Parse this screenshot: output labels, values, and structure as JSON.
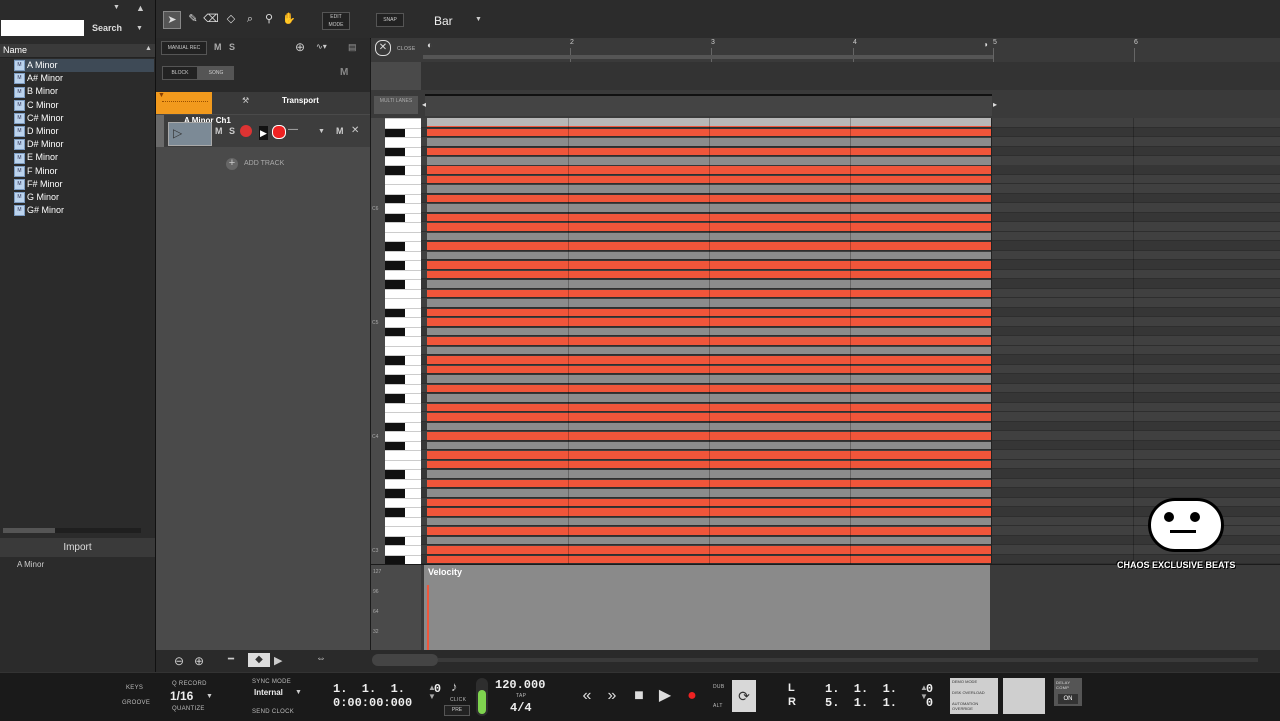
{
  "browser": {
    "search_label": "Search",
    "name_header": "Name",
    "items": [
      "A Minor",
      "A# Minor",
      "B Minor",
      "C Minor",
      "C# Minor",
      "D Minor",
      "D# Minor",
      "E Minor",
      "F Minor",
      "F# Minor",
      "G Minor",
      "G# Minor"
    ],
    "import_label": "Import",
    "selected": "A Minor"
  },
  "toolbar": {
    "edit_mode": "EDIT MODE",
    "snap": "SNAP",
    "snap_value": "Bar"
  },
  "tracks": {
    "manual_rec": "MANUAL REC",
    "m": "M",
    "s": "S",
    "block": "BLOCK",
    "song": "SONG",
    "transport_label": "Transport",
    "track_name": "A Minor Ch1",
    "add_track": "ADD TRACK"
  },
  "editor": {
    "close": "CLOSE",
    "multi_lanes": "MULTI LANES",
    "bars": [
      "2",
      "3",
      "4",
      "5",
      "6"
    ],
    "octaves": [
      "C6",
      "C5",
      "C4",
      "C3"
    ],
    "velocity_label": "Velocity",
    "velocity_ticks": [
      "127",
      "96",
      "64",
      "32"
    ],
    "note_color": "#f0553a",
    "watermark": "CHAOS EXCLUSIVE BEATS"
  },
  "status": {
    "keys": "KEYS",
    "groove": "GROOVE",
    "q_record": "Q RECORD",
    "quantize_value": "1/16",
    "quantize": "QUANTIZE",
    "sync_mode": "SYNC MODE",
    "sync_value": "Internal",
    "send_clock": "SEND CLOCK",
    "position_bars": "1.  1.  1.    0",
    "position_time": "0:00:00:000",
    "click": "CLICK",
    "pre": "PRE",
    "tempo": "120.000",
    "tap": "TAP",
    "signature": "4/4",
    "dub": "DUB",
    "alt": "ALT",
    "loop_l_label": "L",
    "loop_r_label": "R",
    "loop_l": "1.  1.  1.    0",
    "loop_r": "5.  1.  1.    0",
    "demo_mode": "DEMO MODE",
    "disk_overload": "DISK OVERLOAD",
    "automation_override": "AUTOMATION OVERRIDE",
    "delay_comp": "DELAY COMP",
    "on": "ON"
  }
}
